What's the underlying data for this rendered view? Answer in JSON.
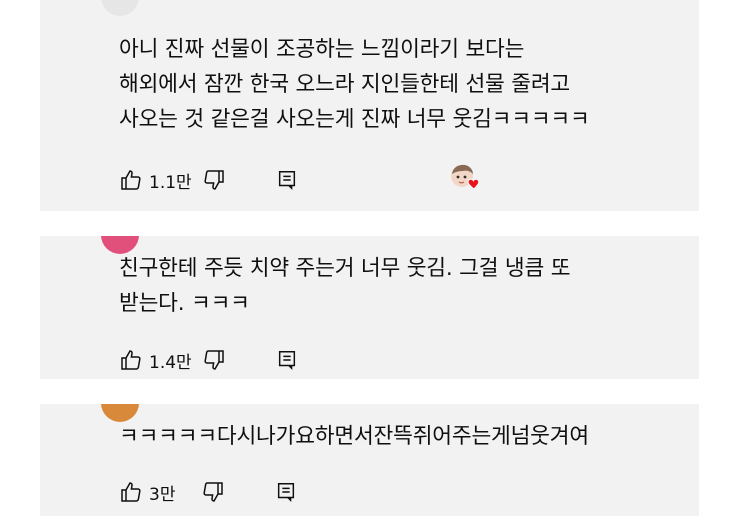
{
  "comments": [
    {
      "lines": [
        "아니 진짜 선물이 조공하는 느낌이라기 보다는",
        "해외에서 잠깐 한국 오느라 지인들한테 선물 줄려고",
        "사오는 것 같은걸 사오는게 진짜 너무 웃김ㅋㅋㅋㅋㅋ"
      ],
      "likes": "1.1만",
      "has_creator_heart": true
    },
    {
      "lines": [
        "친구한테 주듯 치약 주는거 너무 웃김. 그걸 냉큼 또",
        "받는다. ㅋㅋㅋ"
      ],
      "likes": "1.4만",
      "has_creator_heart": false
    },
    {
      "lines": [
        "ㅋㅋㅋㅋㅋ다시나가요하면서잔뜩쥐어주는게넘웃겨여"
      ],
      "likes": "3만",
      "has_creator_heart": false
    }
  ],
  "icons": {
    "like": "thumbs-up-icon",
    "dislike": "thumbs-down-icon",
    "reply": "reply-icon",
    "heart": "creator-heart-icon"
  },
  "colors": {
    "card_bg": "#f2f2f2",
    "text": "#0f0f0f",
    "heart": "#e8141a",
    "avatar2": "#e0507a",
    "avatar3": "#d9893a"
  }
}
